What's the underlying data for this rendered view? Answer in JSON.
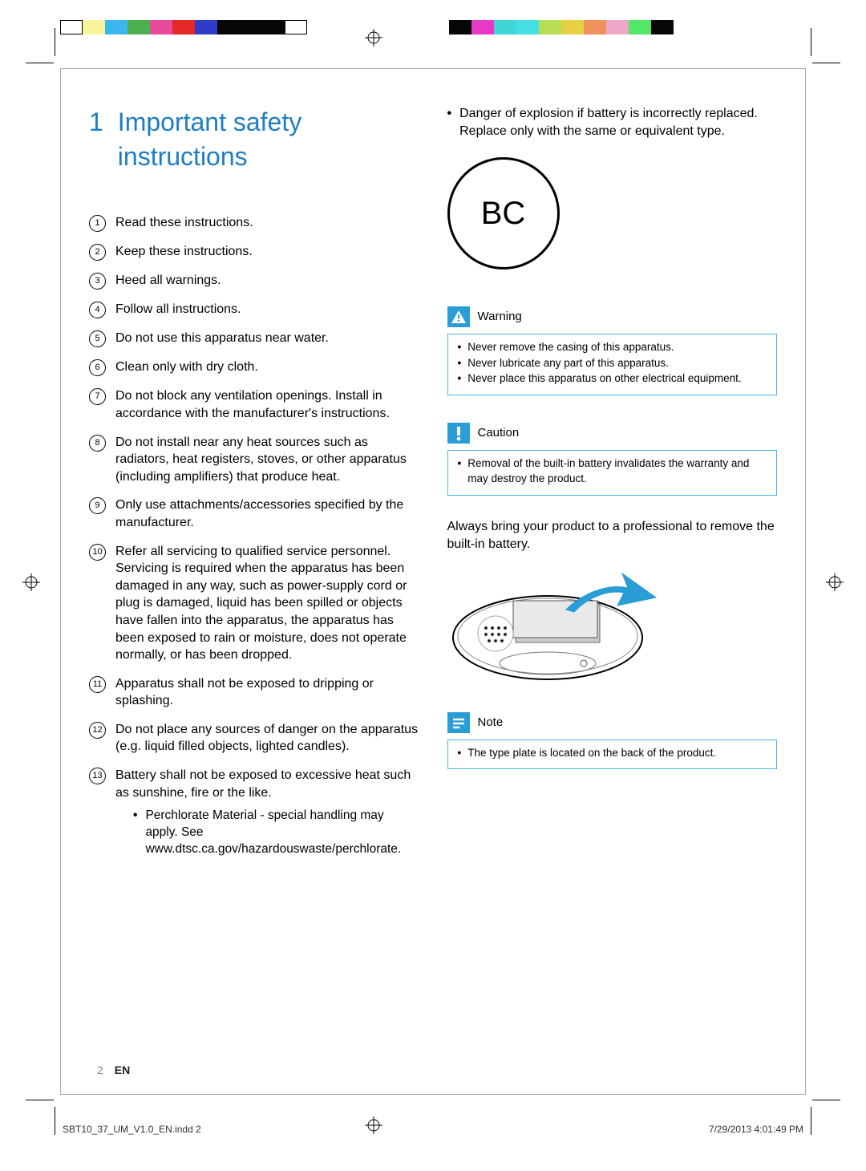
{
  "colorStrips": {
    "left": [
      "#ffffff",
      "#f9f39a",
      "#3ab7ed",
      "#4db050",
      "#e84a9b",
      "#e62828",
      "#2f3cc9",
      "#060606",
      "#060606",
      "#060606",
      "#ffffff"
    ],
    "right": [
      "#060606",
      "#e838c8",
      "#3fd6d6",
      "#46dfe3",
      "#b7de55",
      "#e6d043",
      "#f1925d",
      "#eda8c8",
      "#54e86b",
      "#060606"
    ]
  },
  "heading": {
    "num": "1",
    "text": "Important safety instructions"
  },
  "list": [
    "Read these instructions.",
    "Keep these instructions.",
    "Heed all warnings.",
    "Follow all instructions.",
    "Do not use this apparatus near water.",
    "Clean only with dry cloth.",
    "Do not block any ventilation openings. Install in accordance with the manufacturer's instructions.",
    "Do not install near any heat sources such as radiators, heat registers, stoves, or other apparatus (including amplifiers) that produce heat.",
    "Only use attachments/accessories specified by the manufacturer.",
    "Refer all servicing to qualified service personnel. Servicing is required when the apparatus has been damaged in any way, such as power-supply cord or plug is damaged, liquid has been spilled or objects have fallen into the apparatus, the apparatus has been exposed to rain or moisture, does not operate normally, or has been dropped.",
    "Apparatus shall not be exposed to dripping or splashing.",
    "Do not place any sources of danger on the apparatus (e.g. liquid filled objects, lighted candles).",
    "Battery shall not be exposed to excessive heat such as sunshine, fire or the like."
  ],
  "subbullet13": "Perchlorate Material - special handling may apply. See www.dtsc.ca.gov/hazardouswaste/perchlorate.",
  "rightTopBullet": "Danger of explosion if battery is incorrectly replaced. Replace only with the same or equivalent type.",
  "bcLabel": "BC",
  "warning": {
    "title": "Warning",
    "items": [
      "Never remove the casing of this apparatus.",
      "Never lubricate any part of this apparatus.",
      "Never place this apparatus on other electrical equipment."
    ]
  },
  "caution": {
    "title": "Caution",
    "items": [
      "Removal of the built-in battery invalidates the warranty and may destroy the product."
    ]
  },
  "paragraph": "Always bring your product to a professional to remove the built-in battery.",
  "note": {
    "title": "Note",
    "items": [
      "The type plate is located on the back of the product."
    ]
  },
  "pageFooter": {
    "page": "2",
    "lang": "EN"
  },
  "outerFooter": {
    "left": "SBT10_37_UM_V1.0_EN.indd   2",
    "right": "7/29/2013   4:01:49 PM"
  }
}
